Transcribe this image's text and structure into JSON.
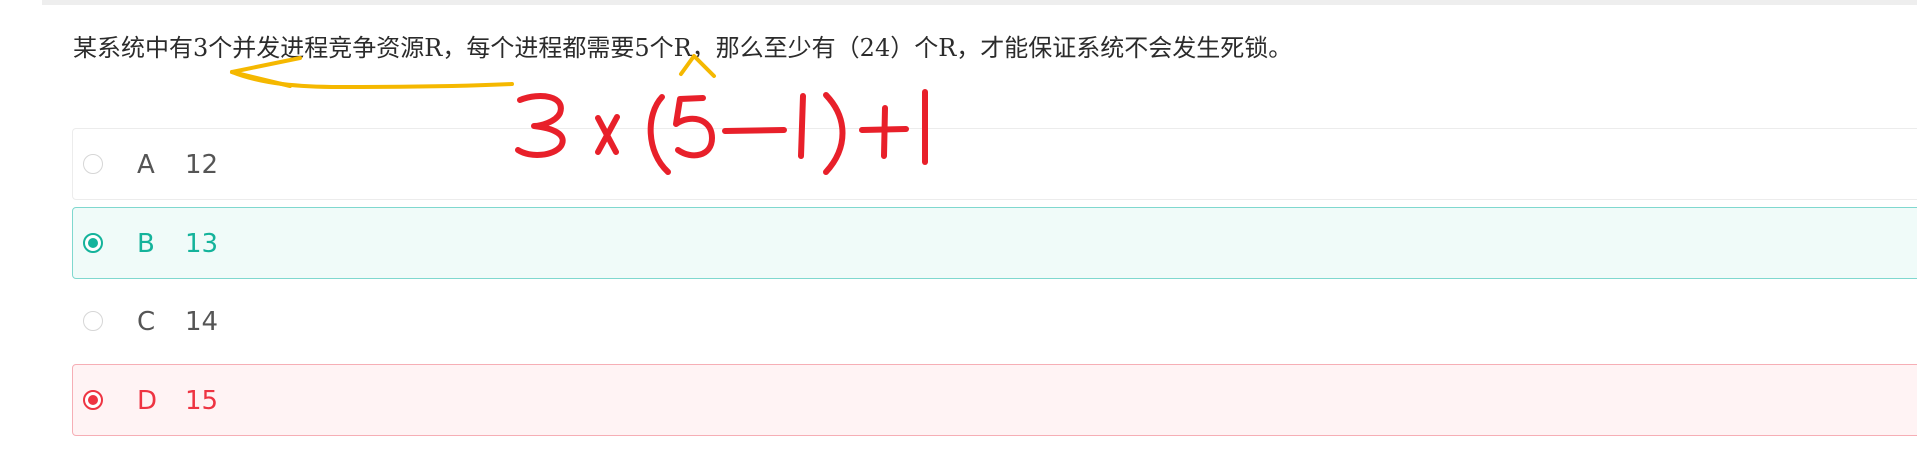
{
  "question": {
    "text": "某系统中有3个并发进程竞争资源R，每个进程都需要5个R，那么至少有（24）个R，才能保证系统不会发生死锁。"
  },
  "options": [
    {
      "letter": "A",
      "value": "12",
      "state": "unselected"
    },
    {
      "letter": "B",
      "value": "13",
      "state": "correct"
    },
    {
      "letter": "C",
      "value": "14",
      "state": "unselected"
    },
    {
      "letter": "D",
      "value": "15",
      "state": "selected-wrong"
    }
  ],
  "handwriting": {
    "formula": "3 x (5-1)+1",
    "formula_color": "#e8202a",
    "arrow_color": "#f5b800"
  },
  "colors": {
    "correct": "#14b39b",
    "wrong": "#ee3442",
    "correct_bg": "#f0fbf9",
    "wrong_bg": "#fff3f4"
  }
}
